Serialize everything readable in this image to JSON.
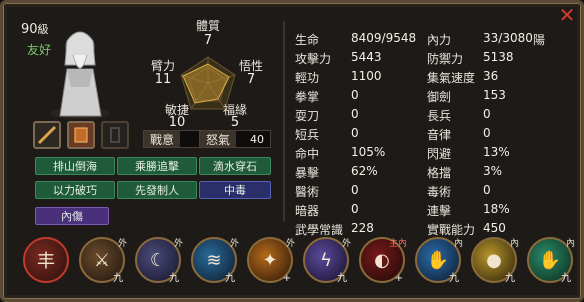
{
  "character": {
    "level_number": "90",
    "level_suffix": "級",
    "mood": "友好"
  },
  "radar": {
    "top": {
      "label": "體質",
      "value": "7"
    },
    "left": {
      "label": "臂力",
      "value": "11"
    },
    "right": {
      "label": "悟性",
      "value": "7"
    },
    "bottom_left": {
      "label": "敏捷",
      "value": "10"
    },
    "bottom_right": {
      "label": "福緣",
      "value": "5"
    }
  },
  "stats": {
    "war_intent_label": "戰意",
    "war_intent_value": "90",
    "anger_label": "怒氣",
    "anger_value": "40"
  },
  "skills_buttons": [
    {
      "label": "排山倒海",
      "style": "green"
    },
    {
      "label": "乘勝追擊",
      "style": "green"
    },
    {
      "label": "滴水穿石",
      "style": "green"
    },
    {
      "label": "以力破巧",
      "style": "green"
    },
    {
      "label": "先發制人",
      "style": "green"
    },
    {
      "label": "中毒",
      "style": "blue"
    },
    {
      "label": "內傷",
      "style": "purple"
    }
  ],
  "attributes_left": [
    {
      "name": "生命",
      "value": "8409/9548"
    },
    {
      "name": "攻擊力",
      "value": "5443"
    },
    {
      "name": "輕功",
      "value": "1100"
    },
    {
      "name": "拳掌",
      "value": "0"
    },
    {
      "name": "耍刀",
      "value": "0"
    },
    {
      "name": "短兵",
      "value": "0"
    },
    {
      "name": "命中",
      "value": "105%"
    },
    {
      "name": "暴擊",
      "value": "62%"
    },
    {
      "name": "醫術",
      "value": "0"
    },
    {
      "name": "暗器",
      "value": "0"
    },
    {
      "name": "武學常識",
      "value": "228"
    }
  ],
  "attributes_right": [
    {
      "name": "內力",
      "value": "33/3080"
    },
    {
      "name": "防禦力",
      "value": "5138"
    },
    {
      "name": "集氣速度",
      "value": "36"
    },
    {
      "name": "御劍",
      "value": "153"
    },
    {
      "name": "長兵",
      "value": "0"
    },
    {
      "name": "音律",
      "value": "0"
    },
    {
      "name": "閃避",
      "value": "13%"
    },
    {
      "name": "格擋",
      "value": "3%"
    },
    {
      "name": "毒術",
      "value": "0"
    },
    {
      "name": "連擊",
      "value": "18%"
    },
    {
      "name": "實戰能力",
      "value": "450"
    }
  ],
  "alignment": "陽",
  "skill_bar": [
    {
      "tag": "",
      "level": "",
      "icon": "claw-strike-icon"
    },
    {
      "tag": "外",
      "level": "九",
      "icon": "sword-slash-icon"
    },
    {
      "tag": "外",
      "level": "九",
      "icon": "crescent-slash-icon"
    },
    {
      "tag": "外",
      "level": "九",
      "icon": "ice-slash-icon"
    },
    {
      "tag": "外",
      "level": "+",
      "icon": "flame-strike-icon"
    },
    {
      "tag": "外",
      "level": "九",
      "icon": "lightning-slash-icon"
    },
    {
      "tag": "主內",
      "level": "+",
      "icon": "red-crescent-icon"
    },
    {
      "tag": "內",
      "level": "九",
      "icon": "water-palm-icon"
    },
    {
      "tag": "內",
      "level": "九",
      "icon": "golden-orb-icon"
    },
    {
      "tag": "內",
      "level": "九",
      "icon": "green-palm-icon"
    }
  ]
}
